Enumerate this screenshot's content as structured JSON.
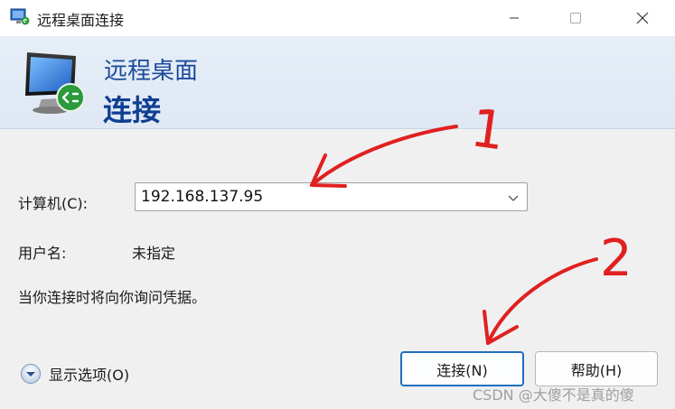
{
  "window": {
    "title": "远程桌面连接",
    "controls": {
      "minimize": "minimize-icon",
      "maximize": "maximize-icon",
      "close": "close-icon"
    }
  },
  "banner": {
    "line1": "远程桌面",
    "line2": "连接",
    "icon": "remote-desktop-icon"
  },
  "form": {
    "computer_label": "计算机(C):",
    "computer_value": "192.168.137.95",
    "user_label": "用户名:",
    "user_value": "未指定",
    "info": "当你连接时将向你询问凭据。"
  },
  "footer": {
    "options_label": "显示选项(O)",
    "connect_label": "连接(N)",
    "help_label": "帮助(H)"
  },
  "annotations": {
    "marker1": "1",
    "marker2": "2",
    "color": "#e02020"
  },
  "watermark": "CSDN @大傻不是真的傻",
  "colors": {
    "banner_title": "#0f3f94",
    "accent_border": "#1f6fbf"
  }
}
